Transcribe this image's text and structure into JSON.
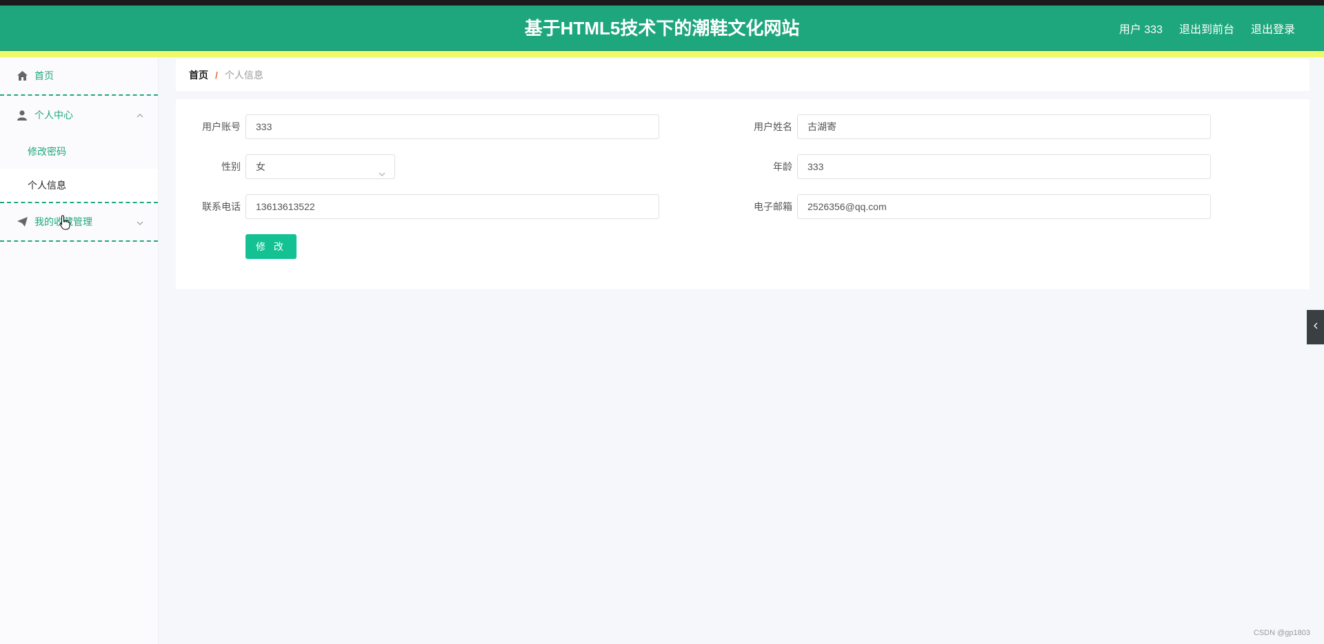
{
  "header": {
    "title": "基于HTML5技术下的潮鞋文化网站",
    "user_label": "用户 333",
    "back_to_front": "退出到前台",
    "logout": "退出登录"
  },
  "sidebar": {
    "home": "首页",
    "personal_center": "个人中心",
    "sub_items": [
      "修改密码",
      "个人信息"
    ],
    "favorites": "我的收藏管理"
  },
  "breadcrumb": {
    "home": "首页",
    "separator": "/",
    "current": "个人信息"
  },
  "form": {
    "account_label": "用户账号",
    "account_value": "333",
    "name_label": "用户姓名",
    "name_value": "古湖寄",
    "gender_label": "性别",
    "gender_value": "女",
    "age_label": "年龄",
    "age_value": "333",
    "phone_label": "联系电话",
    "phone_value": "13613613522",
    "email_label": "电子邮箱",
    "email_value": "2526356@qq.com",
    "submit_label": "修 改"
  },
  "watermark": "CSDN @gp1803",
  "colors": {
    "accent": "#1ea77c",
    "button": "#14c193",
    "yellow_bar": "#eef96a",
    "breadcrumb_separator": "#e4703a"
  }
}
